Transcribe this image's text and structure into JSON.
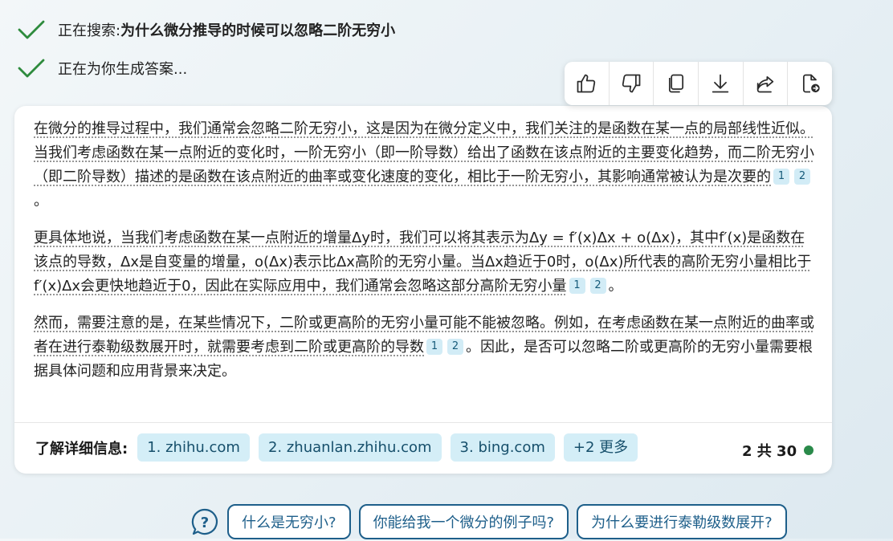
{
  "status": {
    "search_prefix": "正在搜索: ",
    "search_query": "为什么微分推导的时候可以忽略二阶无穷小",
    "generating": "正在为你生成答案..."
  },
  "answer": {
    "p1": {
      "text": "在微分的推导过程中，我们通常会忽略二阶无穷小，这是因为在微分定义中，我们关注的是函数在某一点的局部线性近似。当我们考虑函数在某一点附近的变化时，一阶无穷小（即一阶导数）给出了函数在该点附近的主要变化趋势，而二阶无穷小（即二阶导数）描述的是函数在该点附近的曲率或变化速度的变化，相比于一阶无穷小，其影响通常被认为是次要的",
      "citations": [
        "1",
        "2"
      ],
      "end": "。"
    },
    "p2": {
      "text": "更具体地说，当我们考虑函数在某一点附近的增量Δy时，我们可以将其表示为Δy = f′(x)Δx + o(Δx)，其中f′(x)是函数在该点的导数，Δx是自变量的增量，o(Δx)表示比Δx高阶的无穷小量。当Δx趋近于0时，o(Δx)所代表的高阶无穷小量相比于f′(x)Δx会更快地趋近于0，因此在实际应用中，我们通常会忽略这部分高阶无穷小量",
      "citations": [
        "1",
        "2"
      ],
      "end": "。"
    },
    "p3": {
      "text": "然而，需要注意的是，在某些情况下，二阶或更高阶的无穷小量可能不能被忽略。例如，在考虑函数在某一点附近的曲率或者在进行泰勒级数展开时，就需要考虑到二阶或更高阶的导数",
      "citations": [
        "1",
        "2"
      ],
      "end": "。因此，是否可以忽略二阶或更高阶的无穷小量需要根据具体问题和应用背景来决定。"
    }
  },
  "learn_more": {
    "label": "了解详细信息:",
    "sources": [
      "1. zhihu.com",
      "2. zhuanlan.zhihu.com",
      "3. bing.com"
    ],
    "more": "+2 更多"
  },
  "page_count": "2 共 30",
  "suggestions": [
    "什么是无穷小?",
    "你能给我一个微分的例子吗?",
    "为什么要进行泰勒级数展开?"
  ],
  "toolbar_icons": [
    "thumbs-up-icon",
    "thumbs-down-icon",
    "copy-icon",
    "download-icon",
    "share-icon",
    "export-icon"
  ],
  "colors": {
    "check": "#2e8b3d",
    "chip_bg": "#d4eef7",
    "chip_text": "#164f6b",
    "pill_border": "#1e5f8a",
    "dot": "#2a8a4a"
  }
}
